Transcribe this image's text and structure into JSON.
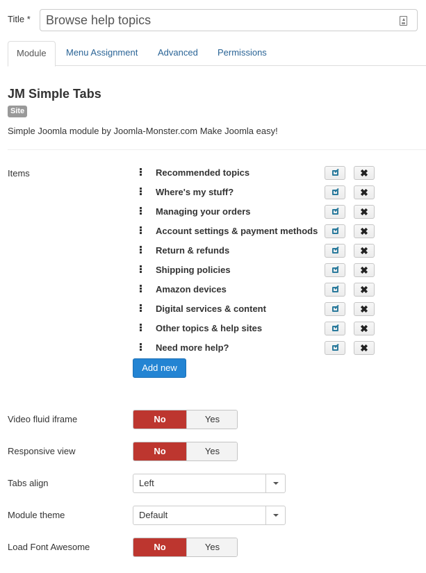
{
  "title_field": {
    "label": "Title *",
    "value": "Browse help topics",
    "icon": "text-toggle-icon"
  },
  "tabs": [
    {
      "label": "Module",
      "active": true
    },
    {
      "label": "Menu Assignment",
      "active": false
    },
    {
      "label": "Advanced",
      "active": false
    },
    {
      "label": "Permissions",
      "active": false
    }
  ],
  "module": {
    "name": "JM Simple Tabs",
    "badge": "Site",
    "description": "Simple Joomla module by Joomla-Monster.com Make Joomla easy!"
  },
  "items": {
    "label": "Items",
    "list": [
      {
        "label": "Recommended topics"
      },
      {
        "label": "Where's my stuff?"
      },
      {
        "label": "Managing your orders"
      },
      {
        "label": "Account settings & payment methods"
      },
      {
        "label": "Return & refunds"
      },
      {
        "label": "Shipping policies"
      },
      {
        "label": "Amazon devices"
      },
      {
        "label": "Digital services & content"
      },
      {
        "label": "Other topics & help sites"
      },
      {
        "label": "Need more help?"
      }
    ],
    "edit_icon": "edit-icon",
    "delete_icon": "✖",
    "add_label": "Add new"
  },
  "settings": {
    "video_fluid_iframe": {
      "label": "Video fluid iframe",
      "no": "No",
      "yes": "Yes",
      "selected": "No"
    },
    "responsive_view": {
      "label": "Responsive view",
      "no": "No",
      "yes": "Yes",
      "selected": "No"
    },
    "tabs_align": {
      "label": "Tabs align",
      "value": "Left"
    },
    "module_theme": {
      "label": "Module theme",
      "value": "Default"
    },
    "load_font_awesome": {
      "label": "Load Font Awesome",
      "no": "No",
      "yes": "Yes",
      "selected": "No"
    }
  },
  "colors": {
    "toggle_active": "#bd362f",
    "primary_button": "#2384d3",
    "link": "#2a6496",
    "badge": "#999999"
  }
}
